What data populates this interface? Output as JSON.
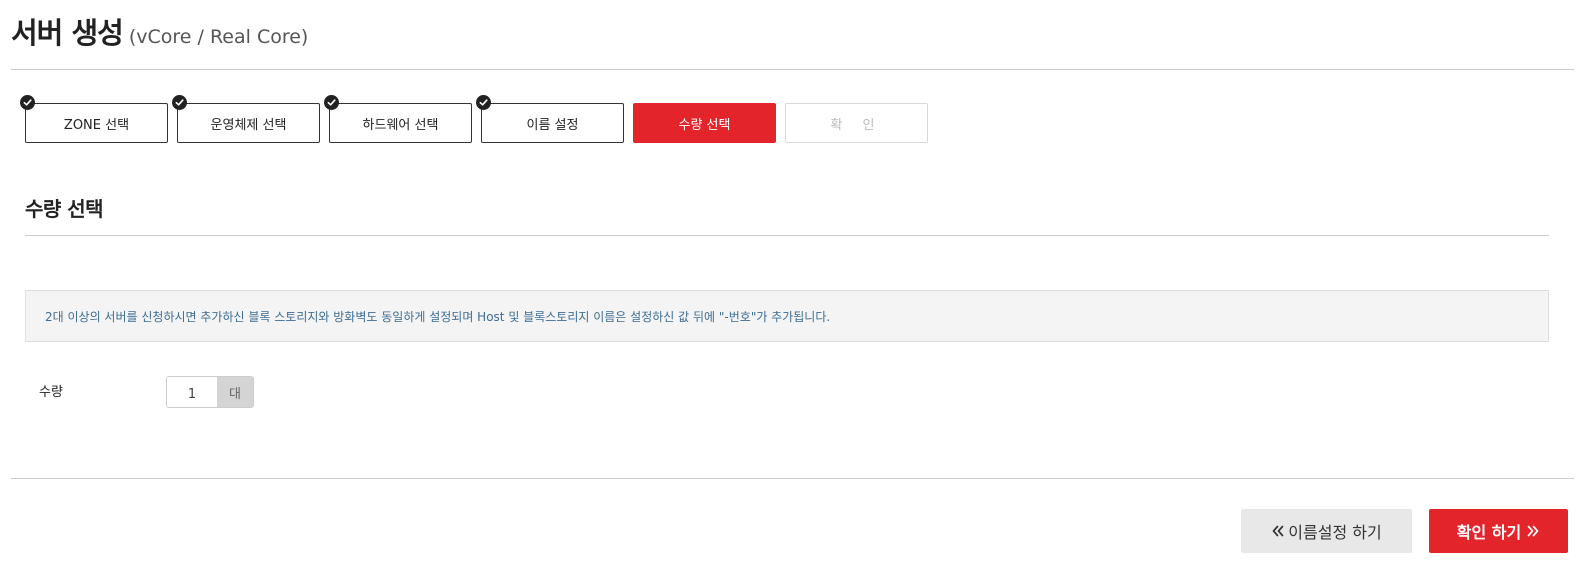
{
  "header": {
    "title": "서버 생성",
    "subtitle": "(vCore / Real Core)"
  },
  "steps": [
    {
      "label": "ZONE 선택",
      "state": "completed"
    },
    {
      "label": "운영체제 선택",
      "state": "completed"
    },
    {
      "label": "하드웨어 선택",
      "state": "completed"
    },
    {
      "label": "이름 설정",
      "state": "completed"
    },
    {
      "label": "수량 선택",
      "state": "active"
    },
    {
      "label": "확 인",
      "state": "disabled"
    }
  ],
  "section": {
    "title": "수량 선택"
  },
  "notice": {
    "text": "2대 이상의 서버를 신청하시면 추가하신 블록 스토리지와 방화벽도 동일하게 설정되며 Host 및 블록스토리지 이름은 설정하신 값 뒤에 \"-번호\"가 추가됩니다."
  },
  "quantity": {
    "label": "수량",
    "value": "1",
    "unit": "대"
  },
  "buttons": {
    "prev_label": "이름설정 하기",
    "next_label": "확인 하기"
  },
  "colors": {
    "accent": "#e3242b",
    "notice_text": "#3e6d93",
    "notice_bg": "#f4f4f4"
  },
  "icons": {
    "step_check": "check-icon",
    "prev": "double-chevron-left-icon",
    "next": "double-chevron-right-icon"
  }
}
